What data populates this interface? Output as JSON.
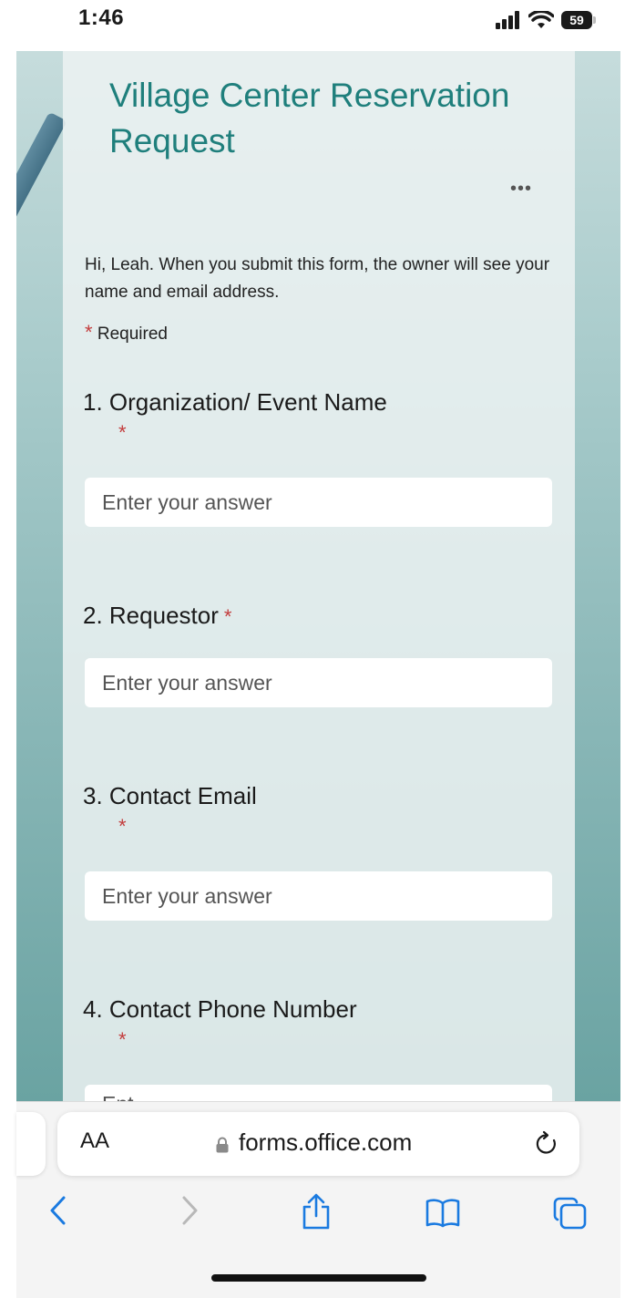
{
  "status_bar": {
    "time": "1:46",
    "battery": "59"
  },
  "form": {
    "title": "Village Center Reservation Request",
    "more_label": "•••",
    "intro": "Hi, Leah. When you submit this form, the owner will see your name and email address.",
    "required_star": "*",
    "required_label": "Required",
    "questions": [
      {
        "label": "1. Organization/ Event Name",
        "star": "*",
        "placeholder": "Enter your answer"
      },
      {
        "label": "2. Requestor",
        "star": "*",
        "placeholder": "Enter your answer"
      },
      {
        "label": "3. Contact Email",
        "star": "*",
        "placeholder": "Enter your answer"
      },
      {
        "label": "4. Contact Phone Number",
        "star": "*",
        "placeholder": "Ent"
      }
    ]
  },
  "browser": {
    "text_size_label": "AA",
    "url": "forms.office.com"
  },
  "icons": {
    "signal": "cellular-signal-icon",
    "wifi": "wifi-icon",
    "battery": "battery-icon",
    "lock": "lock-icon",
    "reload": "reload-icon",
    "back": "back-chevron-icon",
    "forward": "forward-chevron-icon",
    "share": "share-icon",
    "bookmarks": "bookmarks-icon",
    "tabs": "tabs-icon"
  },
  "colors": {
    "title": "#1f7f7c",
    "required": "#c33d3d",
    "link": "#1a7ae0"
  }
}
